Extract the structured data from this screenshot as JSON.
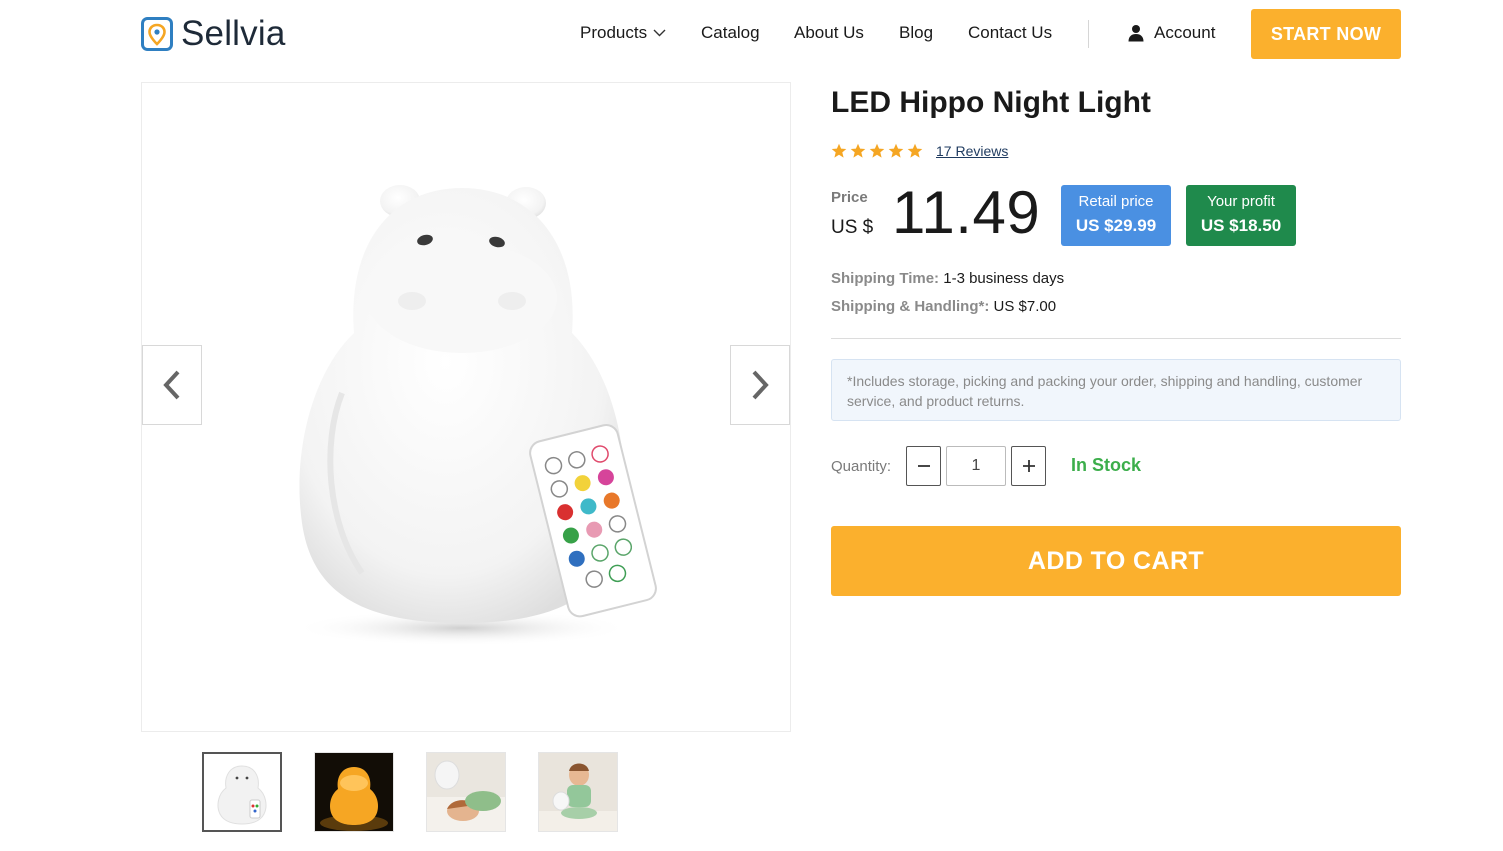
{
  "brand": {
    "name": "Sellvia",
    "accent": "#fbb02d",
    "logo_color": "#2f7fc1"
  },
  "nav": {
    "products": "Products",
    "catalog": "Catalog",
    "about": "About Us",
    "blog": "Blog",
    "contact": "Contact Us",
    "account": "Account",
    "start": "START NOW"
  },
  "product": {
    "title": "LED Hippo Night Light",
    "rating": 5,
    "reviews": "17 Reviews",
    "price_label": "Price",
    "currency": "US $",
    "price": "11.49",
    "retail_label": "Retail price",
    "retail_value": "US $29.99",
    "profit_label": "Your profit",
    "profit_value": "US $18.50",
    "shipping_time_label": "Shipping Time:",
    "shipping_time_value": "1-3 business days",
    "handling_label": "Shipping & Handling*:",
    "handling_value": "US $7.00",
    "note": "*Includes storage, picking and packing your order, shipping and handling, customer service, and product returns.",
    "quantity_label": "Quantity:",
    "quantity": "1",
    "stock": "In Stock",
    "add_to_cart": "ADD TO CART"
  },
  "gallery": {
    "prev_icon": "chevron-left-icon",
    "next_icon": "chevron-right-icon",
    "thumbnails": [
      "hippo-white",
      "hippo-lit",
      "child-sleeping",
      "child-sitting"
    ],
    "active_index": 0
  },
  "colors": {
    "retail_badge": "#4a90e2",
    "profit_badge": "#1f8a4c",
    "in_stock": "#3cae4b",
    "star": "#f5a623"
  }
}
